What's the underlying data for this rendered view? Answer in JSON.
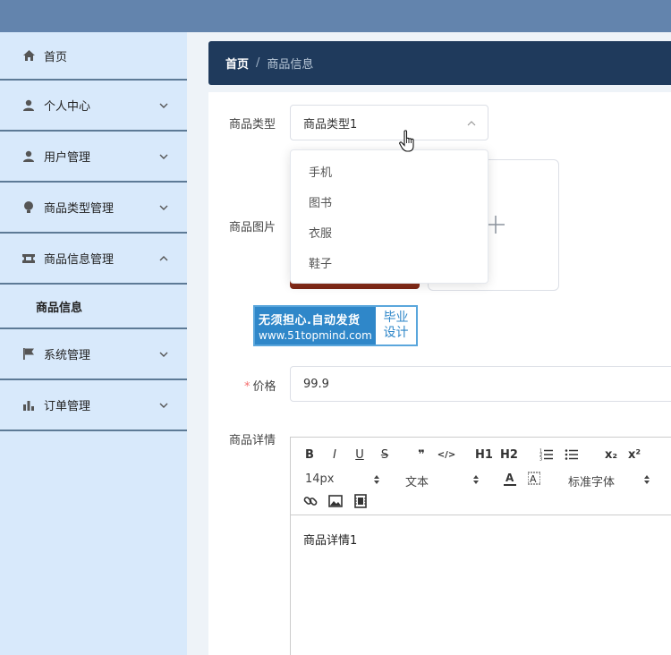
{
  "sidebar": {
    "items": [
      {
        "label": "首页",
        "icon": "home-icon"
      },
      {
        "label": "个人中心",
        "icon": "user-icon"
      },
      {
        "label": "用户管理",
        "icon": "user-icon"
      },
      {
        "label": "商品类型管理",
        "icon": "bulb-icon"
      },
      {
        "label": "商品信息管理",
        "icon": "ticket-icon"
      },
      {
        "label": "系统管理",
        "icon": "flag-icon"
      },
      {
        "label": "订单管理",
        "icon": "bar-chart-icon"
      }
    ],
    "sub_item": "商品信息"
  },
  "breadcrumb": {
    "home": "首页",
    "separator": "/",
    "current": "商品信息"
  },
  "form": {
    "type_label": "商品类型",
    "type_value": "商品类型1",
    "type_options": [
      "手机",
      "图书",
      "衣服",
      "鞋子"
    ],
    "image_label": "商品图片",
    "price_label": "价格",
    "price_required_mark": "*",
    "price_value": "99.9",
    "detail_label": "商品详情",
    "detail_content": "商品详情1"
  },
  "editor": {
    "font_size": "14px",
    "block_type": "文本",
    "font_family": "标准字体",
    "buttons": [
      "B",
      "I",
      "U",
      "S",
      "❞",
      "</>",
      "H1",
      "H2",
      "ordered-list",
      "bullet-list",
      "x₂",
      "x²"
    ]
  },
  "watermark": {
    "line1": "无须担心.自动发货",
    "line2": "www.51topmind.com",
    "badge_line1": "毕业",
    "badge_line2": "设计"
  },
  "colors": {
    "topbar": "#6384ad",
    "sidebar": "#d8e9fb",
    "breadcrumb": "#1f3a5c",
    "required": "#f56c6c"
  }
}
